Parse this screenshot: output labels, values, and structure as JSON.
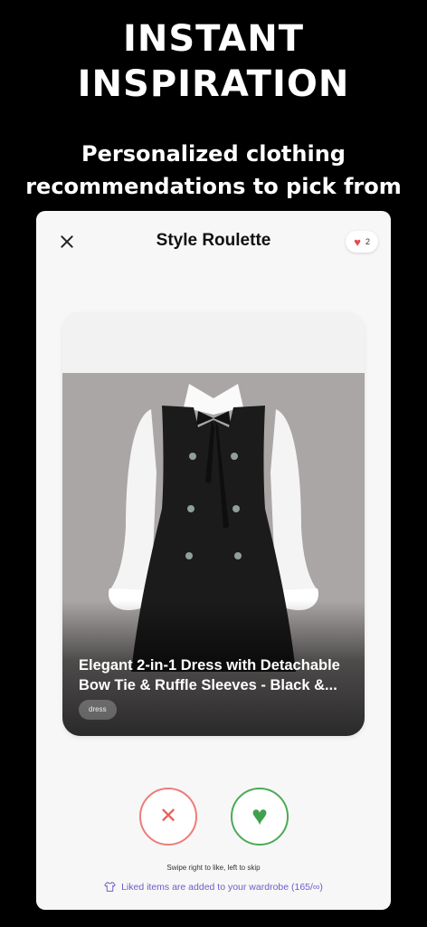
{
  "hero": {
    "title_line1": "INSTANT",
    "title_line2": "INSPIRATION",
    "subtitle_line1": "Personalized clothing",
    "subtitle_line2": "recommendations to pick from"
  },
  "screen": {
    "title": "Style Roulette",
    "close_icon": "close-icon",
    "likes_count": "2",
    "likes_heart": "♥"
  },
  "card": {
    "title": "Elegant 2-in-1 Dress with Detachable Bow Tie & Ruffle Sleeves - Black &...",
    "tag": "dress"
  },
  "actions": {
    "skip_symbol": "✕",
    "like_symbol": "♥",
    "hint": "Swipe right to like, left to skip",
    "footer": "Liked items are added to your wardrobe (165/∞)"
  },
  "colors": {
    "skip": "#ec7d78",
    "like": "#4caa57",
    "footer_text": "#6b5fc7",
    "heart_badge": "#e5484d"
  }
}
